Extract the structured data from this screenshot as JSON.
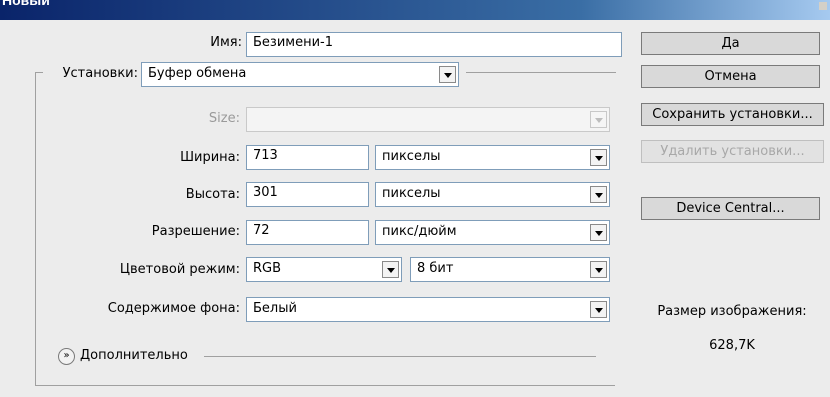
{
  "window": {
    "title": "Новый"
  },
  "form": {
    "name_label": "Имя:",
    "name_value": "Безимени-1",
    "preset_label": "Установки:",
    "preset_value": "Буфер обмена",
    "size_label": "Size:",
    "size_value": "",
    "width_label": "Ширина:",
    "width_value": "713",
    "width_unit": "пикселы",
    "height_label": "Высота:",
    "height_value": "301",
    "height_unit": "пикселы",
    "resolution_label": "Разрешение:",
    "resolution_value": "72",
    "resolution_unit": "пикс/дюйм",
    "color_mode_label": "Цветовой режим:",
    "color_mode_value": "RGB",
    "bit_depth_value": "8 бит",
    "background_label": "Содержимое фона:",
    "background_value": "Белый",
    "advanced_label": "Дополнительно"
  },
  "buttons": {
    "ok": "Да",
    "cancel": "Отмена",
    "save_preset": "Сохранить установки...",
    "delete_preset": "Удалить установки...",
    "device_central": "Device Central..."
  },
  "info": {
    "image_size_label": "Размер изображения:",
    "image_size_value": "628,7K"
  },
  "icons": {
    "dropdown": "chevron-down-icon",
    "advanced_toggle": "double-chevron-down-icon"
  }
}
